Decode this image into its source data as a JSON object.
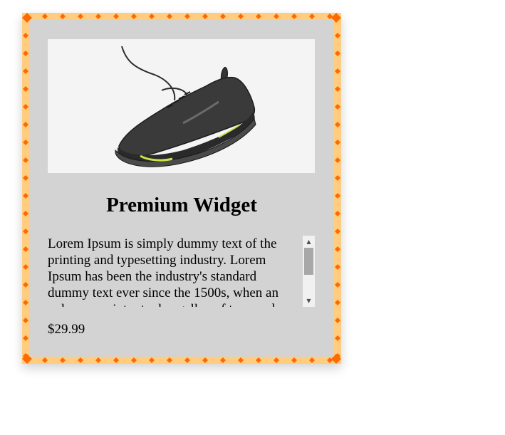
{
  "product": {
    "image_alt": "black sneaker with neon sole",
    "title": "Premium Widget",
    "description": "Lorem Ipsum is simply dummy text of the printing and typesetting industry. Lorem Ipsum has been the industry's standard dummy text ever since the 1500s, when an unknown printer took a galley of type and scrambled it to make a type specimen book.",
    "price": "$29.99"
  },
  "colors": {
    "card_background": "#d3d3d3",
    "border_primary": "#ff6a00",
    "border_secondary": "#ffcc80",
    "image_background": "#f4f4f4"
  },
  "icons": {
    "scroll_up": "triangle-up-icon",
    "scroll_down": "triangle-down-icon"
  }
}
